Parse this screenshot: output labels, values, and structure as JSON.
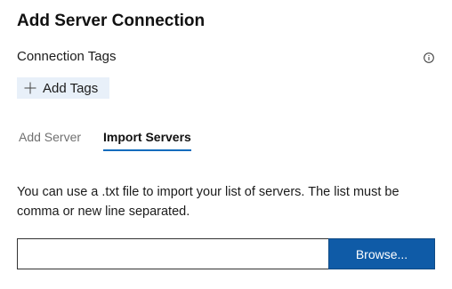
{
  "dialog": {
    "title": "Add Server Connection"
  },
  "tags": {
    "label": "Connection Tags",
    "info_icon": "info-circle-icon",
    "add_button_icon": "plus-icon",
    "add_button_label": "Add Tags"
  },
  "tabs": [
    {
      "label": "Add Server",
      "selected": false
    },
    {
      "label": "Import Servers",
      "selected": true
    }
  ],
  "import": {
    "description": "You can use a .txt file to import your list of servers. The list must be comma or new line separated.",
    "file_value": "",
    "browse_label": "Browse..."
  },
  "colors": {
    "accent": "#0f6cbd",
    "button_bg": "#0f5ba7",
    "tag_button_bg": "#e8f0f9"
  }
}
